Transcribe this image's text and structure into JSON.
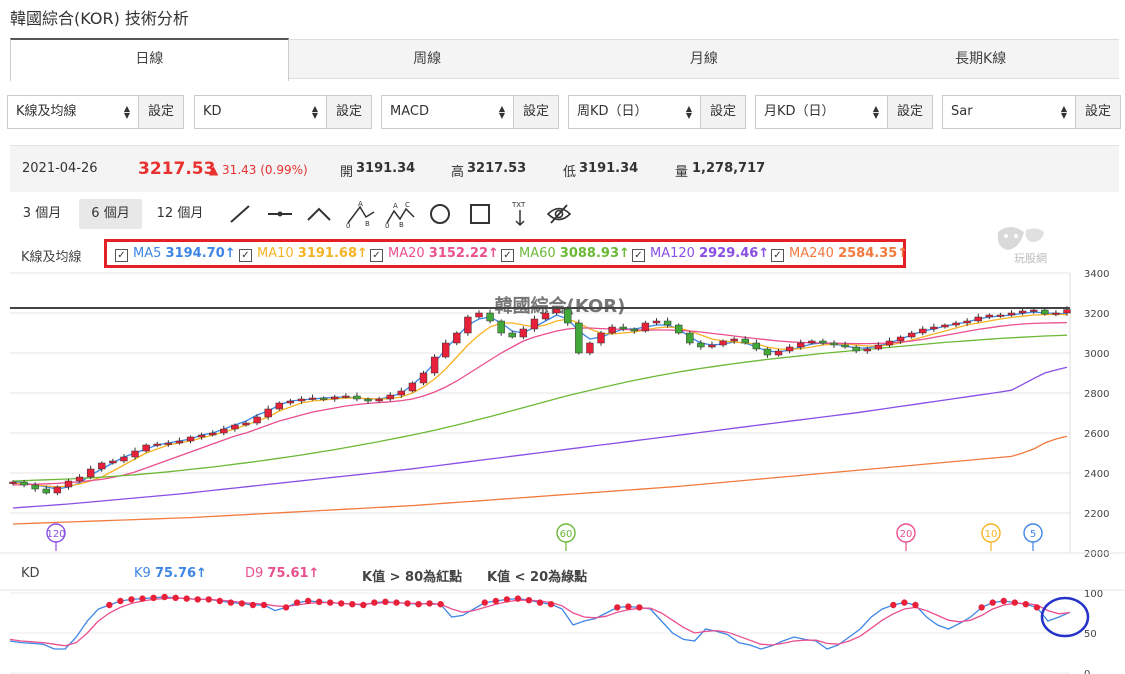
{
  "title": "韓國綜合(KOR) 技術分析",
  "tabs": [
    "日線",
    "周線",
    "月線",
    "長期K線"
  ],
  "selectors": [
    {
      "value": "K線及均線",
      "button": "設定"
    },
    {
      "value": "KD",
      "button": "設定"
    },
    {
      "value": "MACD",
      "button": "設定"
    },
    {
      "value": "周KD（日）",
      "button": "設定"
    },
    {
      "value": "月KD（日）",
      "button": "設定"
    },
    {
      "value": "Sar",
      "button": "設定"
    }
  ],
  "quote": {
    "date": "2021-04-26",
    "price": "3217.53",
    "change": "▲ 31.43 (0.99%)",
    "open_label": "開",
    "open": "3191.34",
    "high_label": "高",
    "high": "3217.53",
    "low_label": "低",
    "low": "3191.34",
    "volume_label": "量",
    "volume": "1,278,717"
  },
  "periods": [
    "3 個月",
    "6 個月",
    "12 個月"
  ],
  "active_period": "6 個月",
  "tools": [
    "line-tool-icon",
    "horizontal-line-icon",
    "wedge-icon",
    "abc-pattern-icon",
    "abcd-pattern-icon",
    "circle-icon",
    "rectangle-icon",
    "text-tool-icon",
    "hide-eye-icon"
  ],
  "tool_text": {
    "abc_a": "A",
    "abc_b": "B",
    "abc_zero": "0",
    "abcd_a": "A",
    "abcd_c": "C",
    "abcd_b": "B",
    "abcd_zero": "0",
    "txt": "TXT"
  },
  "watermark": "玩股網",
  "kline_label": "K線及均線",
  "ma": [
    {
      "name": "MA5",
      "value": "3194.70↑",
      "color": "#3e86e6"
    },
    {
      "name": "MA10",
      "value": "3191.68↑",
      "color": "#f5b324"
    },
    {
      "name": "MA20",
      "value": "3152.22↑",
      "color": "#ea4f8e"
    },
    {
      "name": "MA60",
      "value": "3088.93↑",
      "color": "#6cb937"
    },
    {
      "name": "MA120",
      "value": "2929.46↑",
      "color": "#8a4ee5"
    },
    {
      "name": "MA240",
      "value": "2584.35↑",
      "color": "#f27a3e"
    }
  ],
  "kd": {
    "label": "KD",
    "k_name": "K9",
    "k_value": "75.76↑",
    "k_color": "#3e86e6",
    "d_name": "D9",
    "d_value": "75.61↑",
    "d_color": "#ea4f8e",
    "note_red": "K值 > 80為紅點",
    "note_green": "K值 < 20為綠點"
  },
  "chart_data": [
    {
      "type": "candlestick",
      "title": "韓國綜合(KOR)",
      "ylim": [
        2000,
        3400
      ],
      "yticks": [
        "3400",
        "3200",
        "3000",
        "2800",
        "2600",
        "2400",
        "2200",
        "2000"
      ],
      "reference_line": 3225,
      "ma_markers": [
        "120",
        "60",
        "20",
        "10",
        "5"
      ],
      "close_path": [
        2355,
        2340,
        2320,
        2300,
        2330,
        2360,
        2380,
        2420,
        2450,
        2460,
        2480,
        2510,
        2540,
        2545,
        2550,
        2560,
        2580,
        2590,
        2600,
        2620,
        2640,
        2650,
        2680,
        2720,
        2750,
        2760,
        2770,
        2775,
        2770,
        2780,
        2785,
        2770,
        2760,
        2770,
        2790,
        2810,
        2850,
        2900,
        2980,
        3050,
        3100,
        3180,
        3200,
        3160,
        3100,
        3080,
        3120,
        3170,
        3200,
        3220,
        3150,
        3000,
        3050,
        3100,
        3130,
        3120,
        3110,
        3150,
        3160,
        3140,
        3100,
        3050,
        3030,
        3040,
        3060,
        3070,
        3050,
        3020,
        2990,
        3010,
        3030,
        3050,
        3060,
        3050,
        3040,
        3030,
        3010,
        3020,
        3040,
        3060,
        3080,
        3100,
        3120,
        3130,
        3140,
        3150,
        3160,
        3180,
        3190,
        3190,
        3200,
        3210,
        3215,
        3195,
        3200,
        3217
      ],
      "series": [
        {
          "name": "MA5",
          "values": [
            2360,
            2350,
            2340,
            2330,
            2320,
            2330,
            2350,
            2390,
            2420,
            2450,
            2480,
            2500,
            2520,
            2540,
            2550,
            2560,
            2570,
            2590,
            2600,
            2620,
            2640,
            2660,
            2690,
            2710,
            2740,
            2760,
            2765,
            2770,
            2775,
            2778,
            2780,
            2775,
            2770,
            2770,
            2780,
            2800,
            2840,
            2890,
            2950,
            3020,
            3080,
            3140,
            3170,
            3180,
            3150,
            3110,
            3100,
            3130,
            3160,
            3190,
            3170,
            3110,
            3070,
            3080,
            3100,
            3120,
            3120,
            3130,
            3140,
            3140,
            3120,
            3080,
            3050,
            3040,
            3045,
            3055,
            3050,
            3030,
            3010,
            3005,
            3015,
            3030,
            3045,
            3050,
            3045,
            3035,
            3025,
            3025,
            3035,
            3050,
            3070,
            3090,
            3110,
            3120,
            3135,
            3145,
            3155,
            3170,
            3180,
            3185,
            3190,
            3198,
            3205,
            3200,
            3198,
            3195
          ]
        },
        {
          "name": "MA10",
          "values": [
            2350,
            2345,
            2340,
            2335,
            2330,
            2335,
            2345,
            2360,
            2380,
            2410,
            2440,
            2470,
            2500,
            2520,
            2540,
            2550,
            2560,
            2575,
            2590,
            2605,
            2620,
            2640,
            2660,
            2680,
            2710,
            2730,
            2750,
            2760,
            2765,
            2770,
            2775,
            2775,
            2772,
            2770,
            2772,
            2780,
            2800,
            2830,
            2870,
            2920,
            2980,
            3040,
            3090,
            3130,
            3150,
            3150,
            3140,
            3130,
            3140,
            3160,
            3170,
            3150,
            3120,
            3100,
            3095,
            3100,
            3105,
            3115,
            3125,
            3130,
            3125,
            3110,
            3090,
            3070,
            3060,
            3055,
            3050,
            3045,
            3030,
            3020,
            3018,
            3022,
            3030,
            3040,
            3045,
            3045,
            3040,
            3035,
            3035,
            3040,
            3050,
            3065,
            3080,
            3095,
            3110,
            3125,
            3140,
            3150,
            3160,
            3170,
            3178,
            3184,
            3190,
            3192,
            3193,
            3192
          ]
        },
        {
          "name": "MA20",
          "values": [
            2340,
            2342,
            2344,
            2346,
            2348,
            2352,
            2356,
            2362,
            2368,
            2378,
            2390,
            2405,
            2425,
            2445,
            2465,
            2485,
            2505,
            2525,
            2545,
            2565,
            2585,
            2600,
            2620,
            2640,
            2660,
            2675,
            2690,
            2705,
            2715,
            2725,
            2735,
            2742,
            2748,
            2752,
            2756,
            2762,
            2770,
            2785,
            2805,
            2830,
            2860,
            2895,
            2930,
            2965,
            3000,
            3030,
            3060,
            3080,
            3095,
            3110,
            3120,
            3125,
            3125,
            3122,
            3120,
            3118,
            3116,
            3115,
            3115,
            3115,
            3113,
            3110,
            3105,
            3098,
            3092,
            3085,
            3078,
            3072,
            3066,
            3060,
            3056,
            3053,
            3051,
            3050,
            3049,
            3048,
            3047,
            3047,
            3048,
            3050,
            3054,
            3060,
            3068,
            3078,
            3088,
            3098,
            3108,
            3118,
            3126,
            3134,
            3140,
            3145,
            3148,
            3150,
            3151,
            3152
          ]
        },
        {
          "name": "MA60",
          "values": [
            2360,
            2362,
            2364,
            2366,
            2368,
            2370,
            2373,
            2376,
            2379,
            2383,
            2387,
            2391,
            2396,
            2401,
            2406,
            2412,
            2418,
            2424,
            2430,
            2437,
            2444,
            2451,
            2458,
            2466,
            2474,
            2482,
            2490,
            2499,
            2508,
            2517,
            2527,
            2537,
            2547,
            2557,
            2568,
            2579,
            2590,
            2602,
            2614,
            2627,
            2640,
            2654,
            2668,
            2682,
            2697,
            2712,
            2727,
            2742,
            2757,
            2772,
            2787,
            2800,
            2813,
            2826,
            2839,
            2851,
            2863,
            2874,
            2885,
            2895,
            2905,
            2914,
            2923,
            2931,
            2939,
            2947,
            2954,
            2961,
            2968,
            2974,
            2980,
            2986,
            2992,
            2998,
            3003,
            3008,
            3013,
            3018,
            3023,
            3028,
            3033,
            3038,
            3043,
            3048,
            3053,
            3057,
            3061,
            3065,
            3069,
            3073,
            3076,
            3079,
            3082,
            3085,
            3087,
            3089
          ]
        },
        {
          "name": "MA120",
          "values": [
            2225,
            2229,
            2233,
            2237,
            2241,
            2245,
            2250,
            2255,
            2260,
            2265,
            2270,
            2275,
            2280,
            2285,
            2290,
            2295,
            2301,
            2307,
            2313,
            2319,
            2325,
            2331,
            2337,
            2343,
            2349,
            2355,
            2361,
            2367,
            2373,
            2379,
            2385,
            2391,
            2397,
            2403,
            2409,
            2415,
            2421,
            2428,
            2435,
            2442,
            2449,
            2456,
            2463,
            2470,
            2477,
            2484,
            2491,
            2498,
            2505,
            2512,
            2519,
            2526,
            2533,
            2540,
            2547,
            2554,
            2561,
            2568,
            2575,
            2582,
            2589,
            2596,
            2603,
            2610,
            2617,
            2624,
            2631,
            2638,
            2645,
            2652,
            2659,
            2666,
            2673,
            2680,
            2687,
            2694,
            2701,
            2709,
            2717,
            2725,
            2733,
            2741,
            2749,
            2757,
            2765,
            2773,
            2781,
            2789,
            2797,
            2805,
            2814,
            2843,
            2872,
            2900,
            2915,
            2929
          ]
        },
        {
          "name": "MA240",
          "values": [
            2145,
            2147,
            2149,
            2151,
            2153,
            2155,
            2157,
            2159,
            2161,
            2163,
            2165,
            2167,
            2169,
            2171,
            2173,
            2175,
            2177,
            2180,
            2183,
            2186,
            2189,
            2192,
            2195,
            2198,
            2201,
            2204,
            2207,
            2210,
            2213,
            2216,
            2219,
            2222,
            2225,
            2228,
            2231,
            2234,
            2237,
            2241,
            2245,
            2249,
            2253,
            2257,
            2261,
            2265,
            2269,
            2273,
            2277,
            2281,
            2285,
            2289,
            2293,
            2297,
            2301,
            2305,
            2309,
            2313,
            2317,
            2321,
            2325,
            2329,
            2333,
            2338,
            2343,
            2348,
            2353,
            2358,
            2363,
            2368,
            2373,
            2378,
            2383,
            2388,
            2393,
            2398,
            2403,
            2408,
            2413,
            2418,
            2423,
            2428,
            2433,
            2438,
            2443,
            2448,
            2453,
            2458,
            2463,
            2468,
            2473,
            2478,
            2483,
            2500,
            2520,
            2550,
            2570,
            2584
          ]
        }
      ]
    },
    {
      "type": "line",
      "title": "KD",
      "ylim": [
        0,
        100
      ],
      "yticks": [
        "100",
        "50",
        "0"
      ],
      "series": [
        {
          "name": "K9",
          "values": [
            40,
            38,
            37,
            36,
            30,
            30,
            45,
            65,
            80,
            85,
            90,
            92,
            93,
            94,
            95,
            94,
            93,
            92,
            92,
            90,
            88,
            87,
            85,
            85,
            78,
            82,
            88,
            90,
            89,
            88,
            87,
            86,
            85,
            88,
            89,
            88,
            87,
            86,
            87,
            86,
            70,
            72,
            80,
            88,
            90,
            92,
            93,
            91,
            88,
            86,
            80,
            60,
            65,
            68,
            75,
            82,
            83,
            82,
            80,
            65,
            50,
            42,
            40,
            55,
            52,
            48,
            38,
            35,
            30,
            34,
            40,
            45,
            42,
            40,
            30,
            35,
            45,
            55,
            70,
            80,
            85,
            88,
            85,
            70,
            60,
            55,
            62,
            70,
            82,
            88,
            90,
            88,
            86,
            82,
            65,
            70,
            76
          ]
        },
        {
          "name": "D9",
          "values": [
            42,
            40,
            39,
            38,
            36,
            34,
            38,
            50,
            65,
            75,
            82,
            87,
            90,
            92,
            93,
            94,
            93,
            92,
            92,
            91,
            90,
            88,
            87,
            86,
            84,
            83,
            85,
            87,
            88,
            88,
            87,
            86,
            86,
            87,
            88,
            88,
            87,
            87,
            86,
            86,
            80,
            76,
            78,
            82,
            86,
            89,
            91,
            91,
            90,
            88,
            84,
            75,
            70,
            69,
            71,
            76,
            79,
            81,
            81,
            75,
            66,
            57,
            50,
            52,
            53,
            51,
            46,
            41,
            36,
            35,
            37,
            40,
            41,
            41,
            37,
            36,
            40,
            46,
            56,
            66,
            74,
            80,
            82,
            78,
            72,
            66,
            64,
            66,
            72,
            80,
            85,
            87,
            87,
            85,
            78,
            74,
            75.6
          ]
        }
      ]
    }
  ]
}
